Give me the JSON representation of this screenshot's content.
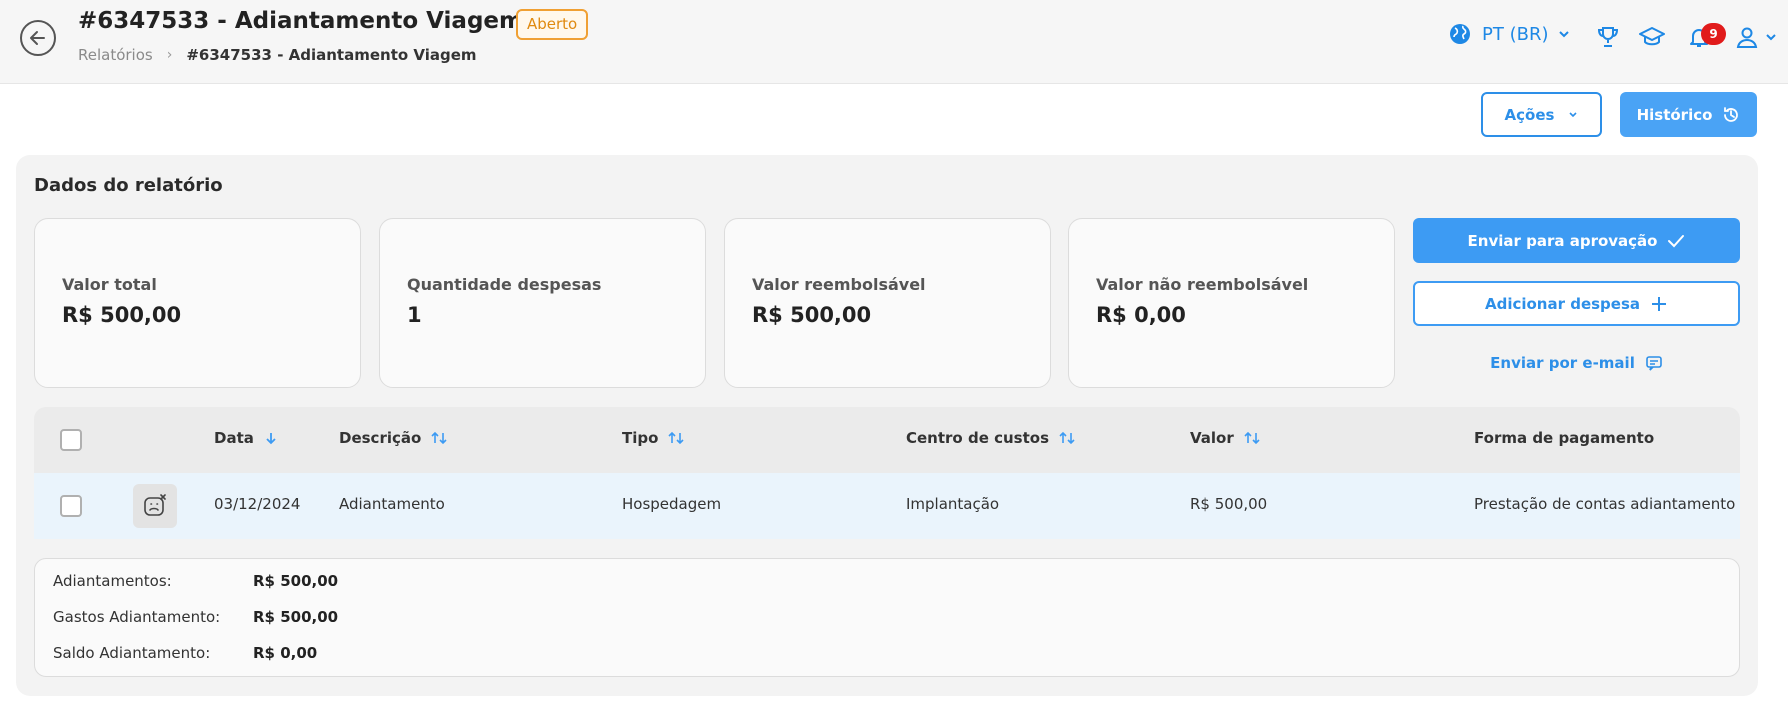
{
  "header": {
    "title": "#6347533 - Adiantamento Viagem",
    "status": "Aberto",
    "breadcrumb": {
      "root": "Relatórios",
      "current": "#6347533 - Adiantamento Viagem"
    },
    "language": "PT (BR)",
    "notification_count": "9",
    "icons": [
      "back-arrow-icon",
      "globe-icon",
      "chevron-down-icon",
      "trophy-icon",
      "graduation-cap-icon",
      "bell-icon",
      "user-icon"
    ]
  },
  "actions": {
    "acoes_label": "Ações",
    "historico_label": "Histórico"
  },
  "panel": {
    "title": "Dados do relatório",
    "cards": [
      {
        "label": "Valor total",
        "value": "R$ 500,00"
      },
      {
        "label": "Quantidade despesas",
        "value": "1"
      },
      {
        "label": "Valor reembolsável",
        "value": "R$ 500,00"
      },
      {
        "label": "Valor não reembolsável",
        "value": "R$ 0,00"
      }
    ],
    "send_approval_label": "Enviar para aprovação",
    "add_expense_label": "Adicionar despesa",
    "send_email_label": "Enviar por e-mail"
  },
  "table": {
    "columns": [
      "Data",
      "Descrição",
      "Tipo",
      "Centro de custos",
      "Valor",
      "Forma de pagamento"
    ],
    "rows": [
      {
        "data": "03/12/2024",
        "descricao": "Adiantamento",
        "tipo": "Hospedagem",
        "centro": "Implantação",
        "valor": "R$ 500,00",
        "pagamento": "Prestação de contas adiantamento"
      }
    ]
  },
  "summary": {
    "items": [
      {
        "label": "Adiantamentos:",
        "value": "R$ 500,00"
      },
      {
        "label": "Gastos Adiantamento:",
        "value": "R$ 500,00"
      },
      {
        "label": "Saldo Adiantamento:",
        "value": "R$ 0,00"
      }
    ]
  },
  "colors": {
    "accent": "#3d9bf3",
    "status": "#f0a033",
    "notification": "#e11b1b"
  }
}
